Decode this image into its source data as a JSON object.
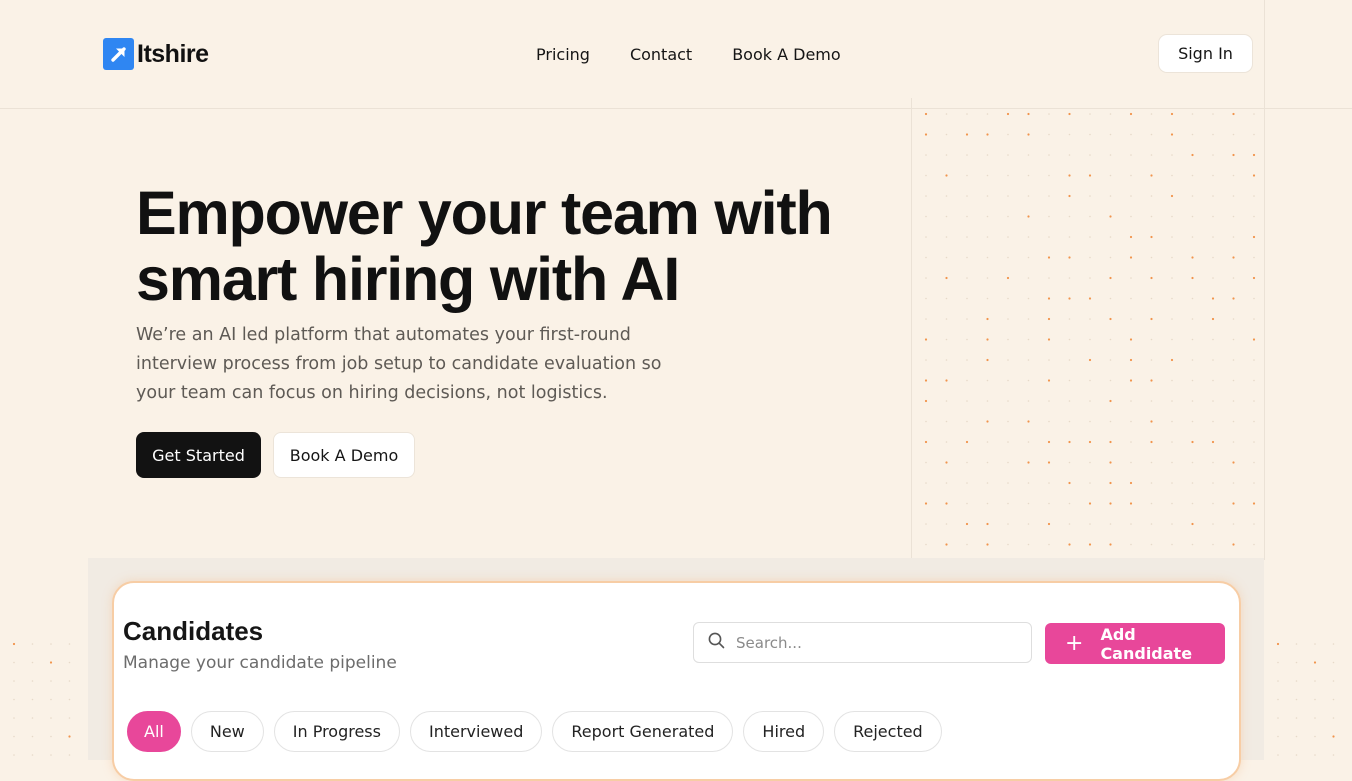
{
  "brand": {
    "name": "Itshire",
    "logo_icon": "arrow-up-right-icon",
    "logo_color": "#2f86f2"
  },
  "nav": {
    "items": [
      {
        "label": "Pricing"
      },
      {
        "label": "Contact"
      },
      {
        "label": "Book A Demo"
      }
    ]
  },
  "header": {
    "signin_label": "Sign In"
  },
  "hero": {
    "title_line1": "Empower your team with",
    "title_line2": "smart hiring with AI",
    "subtitle": "We’re an AI led platform that automates your first-round interview process from job setup to candidate evaluation so your team can focus on hiring decisions, not logistics.",
    "primary_cta": "Get Started",
    "secondary_cta": "Book A Demo"
  },
  "preview": {
    "title": "Candidates",
    "subtitle": "Manage your candidate pipeline",
    "search_placeholder": "Search...",
    "add_button_label": "Add Candidate",
    "filters": [
      {
        "label": "All",
        "active": true
      },
      {
        "label": "New",
        "active": false
      },
      {
        "label": "In Progress",
        "active": false
      },
      {
        "label": "Interviewed",
        "active": false
      },
      {
        "label": "Report Generated",
        "active": false
      },
      {
        "label": "Hired",
        "active": false
      },
      {
        "label": "Rejected",
        "active": false
      }
    ]
  },
  "colors": {
    "background": "#faf2e7",
    "primary_button": "#121212",
    "accent_pink": "#e8479a",
    "dot_orange": "#f08a3c",
    "card_border": "#f7cda5"
  }
}
